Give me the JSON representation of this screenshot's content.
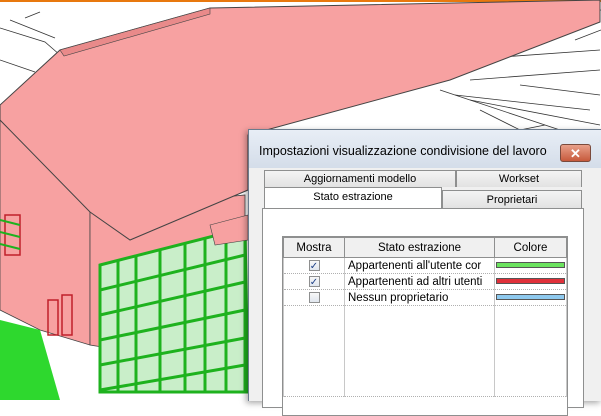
{
  "dialog": {
    "title": "Impostazioni visualizzazione condivisione del lavoro",
    "close_label": "✕",
    "tabs_row1": [
      {
        "label": "Aggiornamenti modello"
      },
      {
        "label": "Workset"
      }
    ],
    "tabs_row2": [
      {
        "label": "Stato estrazione"
      },
      {
        "label": "Proprietari"
      }
    ],
    "table": {
      "headers": [
        "Mostra",
        "Stato estrazione",
        "Colore"
      ],
      "rows": [
        {
          "checked": true,
          "label": "Appartenenti all'utente cor",
          "color": "#6be35f"
        },
        {
          "checked": true,
          "label": "Appartenenti ad altri utenti",
          "color": "#e0303a"
        },
        {
          "checked": false,
          "label": "Nessun proprietario",
          "color": "#8ec9ee"
        }
      ]
    }
  },
  "colors": {
    "roof": "#f7a1a1",
    "facade": "#f7a1a1",
    "curtain_wall": "#1eb21e",
    "accent_orange": "#e8780e"
  }
}
